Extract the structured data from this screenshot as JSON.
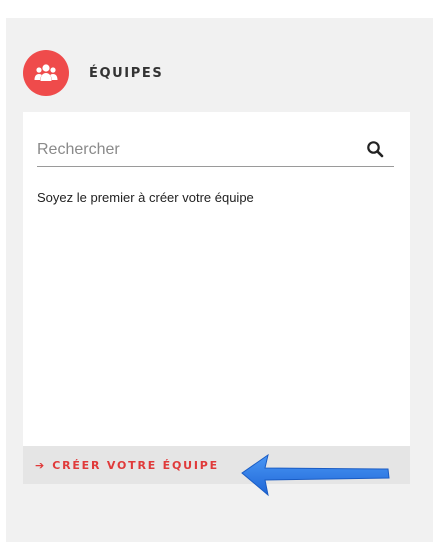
{
  "header": {
    "title": "ÉQUIPES",
    "icon": "team-icon",
    "badge_color": "#ef4b4b"
  },
  "search": {
    "placeholder": "Rechercher",
    "value": "",
    "icon": "search-icon"
  },
  "teams": {
    "empty_message": "Soyez le premier à créer votre équipe"
  },
  "footer": {
    "create_label": "CRÉER VOTRE ÉQUIPE",
    "arrow_glyph": "➔",
    "accent_color": "#e03a3a"
  },
  "annotation": {
    "icon": "annotation-arrow-icon",
    "color": "#2f7fe8"
  }
}
